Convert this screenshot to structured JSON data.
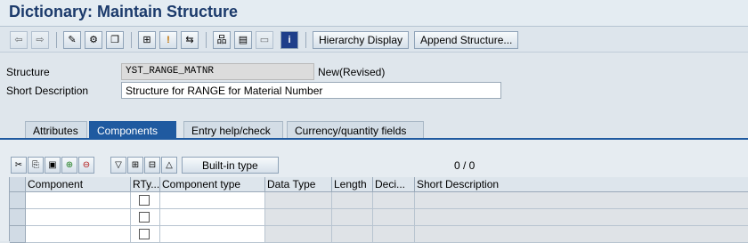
{
  "header": {
    "title": "Dictionary: Maintain Structure"
  },
  "toolbar": {
    "icons": [
      "back-arrow-icon",
      "forward-arrow-icon",
      "edit-pencil-icon",
      "display-change-icon",
      "other-object-icon",
      "where-used-icon",
      "activate-icon",
      "navigate-icon",
      "hierarchy-icon",
      "print-icon",
      "layout-icon",
      "info-icon"
    ],
    "hierarchy_display": "Hierarchy Display",
    "append_structure": "Append Structure..."
  },
  "form": {
    "structure_label": "Structure",
    "structure_value": "YST_RANGE_MATNR",
    "structure_status": "New(Revised)",
    "short_desc_label": "Short Description",
    "short_desc_value": "Structure for RANGE for Material Number"
  },
  "tabs": [
    {
      "label": "Attributes",
      "active": false
    },
    {
      "label": "Components",
      "active": true
    },
    {
      "label": "Entry help/check",
      "active": false
    },
    {
      "label": "Currency/quantity fields",
      "active": false
    }
  ],
  "table_toolbar": {
    "icons": [
      "cut-icon",
      "copy-icon",
      "paste-icon",
      "insert-row-icon",
      "delete-row-icon",
      "sort-icon",
      "expand-icon",
      "collapse-icon",
      "up-icon"
    ],
    "builtin_type": "Built-in type",
    "counter": "0 / 0"
  },
  "table": {
    "columns": [
      "Component",
      "RTy...",
      "Component type",
      "Data Type",
      "Length",
      "Deci...",
      "Short Description"
    ],
    "row_count": 3
  },
  "colors": {
    "title": "#1b3a6b",
    "tab_active": "#1f5aa0"
  }
}
